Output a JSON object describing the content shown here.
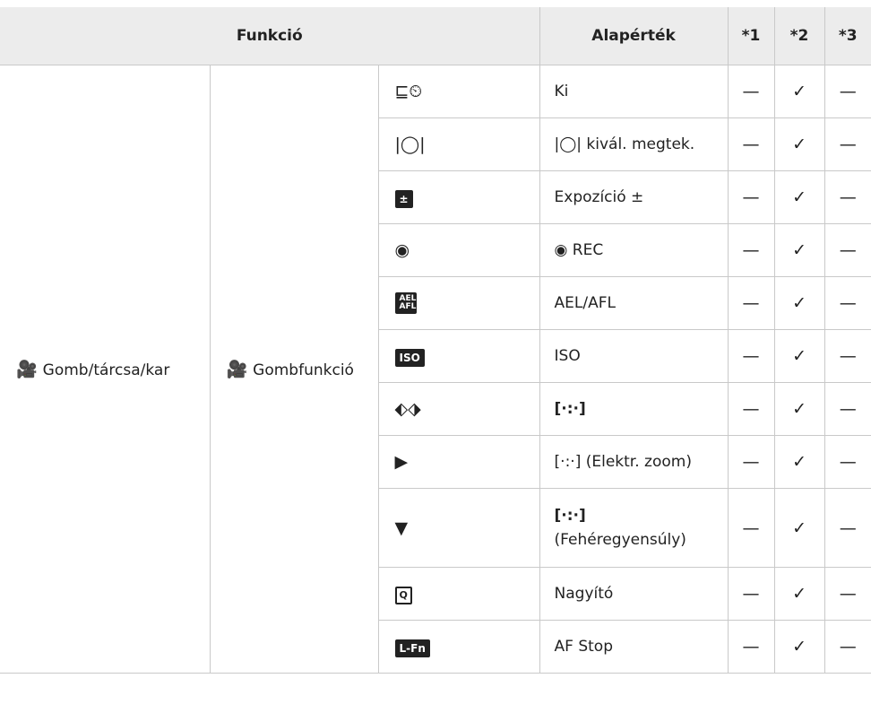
{
  "header": {
    "funkcio": "Funkció",
    "alapertek": "Alapérték",
    "c1": "*1",
    "c2": "*2",
    "c3": "*3"
  },
  "group": {
    "level1_icon": "🎥",
    "level1_label": "Gomb/tárcsa/kar",
    "level2_label": "Gombfunkció"
  },
  "rows": [
    {
      "icon": "⊑⏲",
      "default": "Ki",
      "c1": "—",
      "c2": "✓",
      "c3": "—"
    },
    {
      "icon": "|◯|",
      "default": "|◯| kivál. megtek.",
      "c1": "—",
      "c2": "✓",
      "c3": "—"
    },
    {
      "icon": "±",
      "default": "Expozíció ±",
      "c1": "—",
      "c2": "✓",
      "c3": "—"
    },
    {
      "icon": "◉",
      "default": "◉ REC",
      "c1": "—",
      "c2": "✓",
      "c3": "—"
    },
    {
      "icon": "AEL AFL",
      "default": "AEL/AFL",
      "c1": "—",
      "c2": "✓",
      "c3": "—"
    },
    {
      "icon": "ISO",
      "default": "ISO",
      "c1": "—",
      "c2": "✓",
      "c3": "—"
    },
    {
      "icon": "⬖⬗",
      "default": "[·:·]",
      "c1": "—",
      "c2": "✓",
      "c3": "—"
    },
    {
      "icon": "▶",
      "default": "[·:·] (Elektr. zoom)",
      "c1": "—",
      "c2": "✓",
      "c3": "—"
    },
    {
      "icon": "▼",
      "default_line1": "[·:·]",
      "default_line2": "(Fehéregyensúly)",
      "c1": "—",
      "c2": "✓",
      "c3": "—"
    },
    {
      "icon": "Q",
      "default": "Nagyító",
      "c1": "—",
      "c2": "✓",
      "c3": "—"
    },
    {
      "icon": "L-Fn",
      "default": "AF Stop",
      "c1": "—",
      "c2": "✓",
      "c3": "—"
    }
  ]
}
